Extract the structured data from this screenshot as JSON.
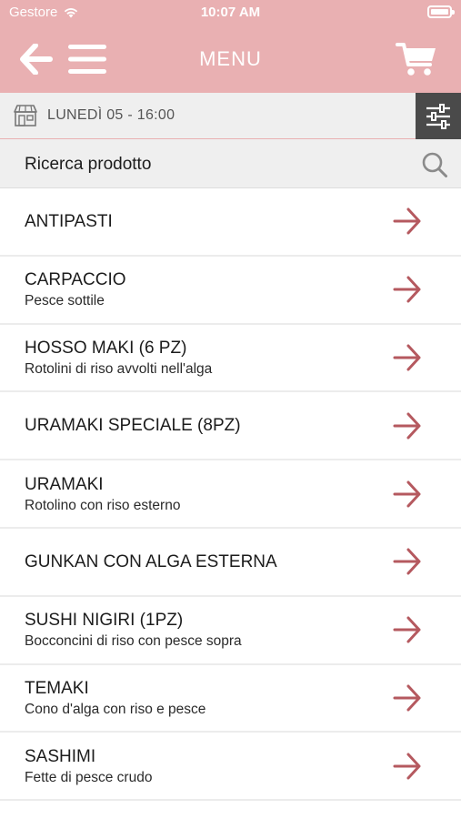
{
  "status": {
    "carrier": "Gestore",
    "time": "10:07 AM"
  },
  "header": {
    "title": "MENU",
    "back_icon": "arrow-left-icon",
    "menu_icon": "hamburger-icon",
    "cart_icon": "cart-icon",
    "color": "#e9b0b2"
  },
  "datebar": {
    "text": "LUNEDÌ 05 - 16:00",
    "icon": "shop-icon",
    "filter_icon": "sliders-icon"
  },
  "search": {
    "label": "Ricerca prodotto",
    "icon": "search-icon"
  },
  "accent": "#b5595f",
  "categories": [
    {
      "title": "ANTIPASTI",
      "subtitle": ""
    },
    {
      "title": "CARPACCIO",
      "subtitle": "Pesce sottile"
    },
    {
      "title": "HOSSO MAKI (6 PZ)",
      "subtitle": "Rotolini di riso avvolti nell'alga"
    },
    {
      "title": "URAMAKI SPECIALE (8PZ)",
      "subtitle": ""
    },
    {
      "title": "URAMAKI",
      "subtitle": "Rotolino con riso esterno"
    },
    {
      "title": "GUNKAN CON ALGA ESTERNA",
      "subtitle": ""
    },
    {
      "title": "SUSHI NIGIRI (1PZ)",
      "subtitle": "Bocconcini di riso con pesce sopra"
    },
    {
      "title": "TEMAKI",
      "subtitle": "Cono d'alga con riso e pesce"
    },
    {
      "title": "SASHIMI",
      "subtitle": "Fette di pesce crudo"
    }
  ]
}
